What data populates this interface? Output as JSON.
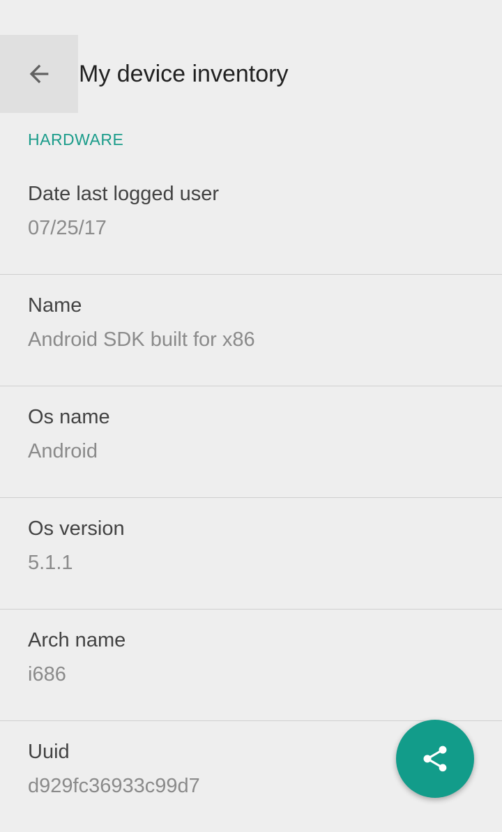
{
  "toolbar": {
    "title": "My device inventory",
    "back_icon": "arrow-left-icon"
  },
  "section": {
    "header": "HARDWARE"
  },
  "items": [
    {
      "label": "Date last logged user",
      "value": "07/25/17"
    },
    {
      "label": "Name",
      "value": "Android SDK built for x86"
    },
    {
      "label": "Os name",
      "value": "Android"
    },
    {
      "label": "Os version",
      "value": "5.1.1"
    },
    {
      "label": "Arch name",
      "value": "i686"
    },
    {
      "label": "Uuid",
      "value": "d929fc36933c99d7"
    }
  ],
  "fab": {
    "icon": "share-icon"
  },
  "colors": {
    "accent": "#129c8a",
    "background": "#eeeeee"
  }
}
